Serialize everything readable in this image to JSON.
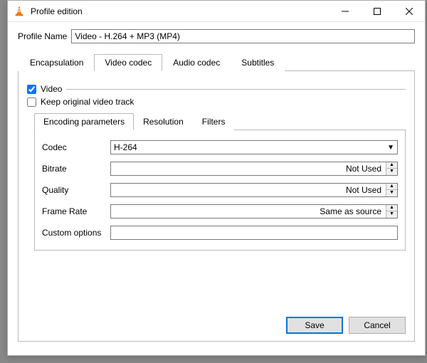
{
  "window": {
    "title": "Profile edition"
  },
  "profile": {
    "label": "Profile Name",
    "value": "Video - H.264 + MP3 (MP4)"
  },
  "main_tabs": {
    "encapsulation": "Encapsulation",
    "video_codec": "Video codec",
    "audio_codec": "Audio codec",
    "subtitles": "Subtitles"
  },
  "video_section": {
    "video_check": "Video",
    "keep_original": "Keep original video track"
  },
  "sub_tabs": {
    "encoding": "Encoding parameters",
    "resolution": "Resolution",
    "filters": "Filters"
  },
  "codec": {
    "label": "Codec",
    "value": "H-264"
  },
  "bitrate": {
    "label": "Bitrate",
    "value": "Not Used"
  },
  "quality": {
    "label": "Quality",
    "value": "Not Used"
  },
  "framerate": {
    "label": "Frame Rate",
    "value": "Same as source"
  },
  "custom": {
    "label": "Custom options",
    "value": ""
  },
  "buttons": {
    "save": "Save",
    "cancel": "Cancel"
  }
}
